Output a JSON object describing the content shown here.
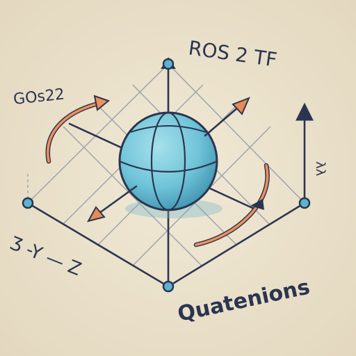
{
  "labels": {
    "title": "ROS 2 TF",
    "top_left": "GOs22",
    "right_axis": "λλ",
    "left_axes": "Ʒ -Y — Z",
    "bottom": "Quatenions"
  },
  "colors": {
    "background": "#ece3ce",
    "ink": "#2b3550",
    "grid": "#9aa0aa",
    "sphere": "#6fc4d8",
    "sphere_shadow": "#4a9fb8",
    "node": "#5bb3cf",
    "arrow": "#e88a55",
    "rotation_arrow": "#f0905a"
  },
  "icons": {
    "sphere": "globe-icon",
    "rotation": "curved-arrow-icon",
    "node": "circle-dot-icon"
  }
}
